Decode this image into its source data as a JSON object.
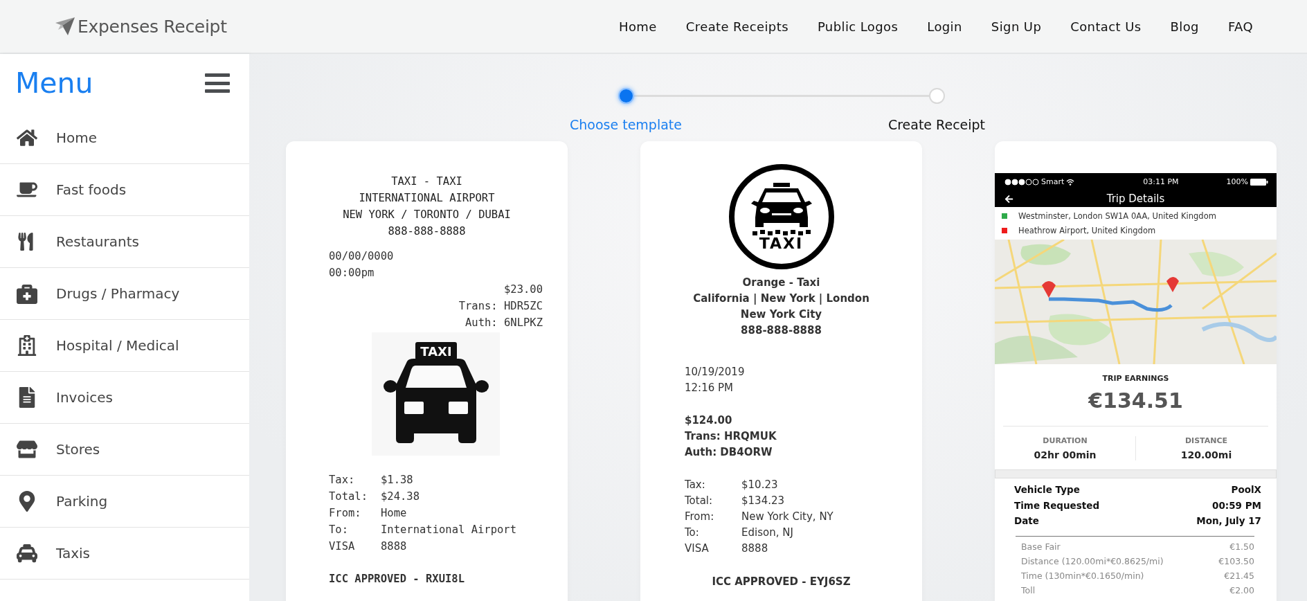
{
  "header": {
    "logo": "Expenses Receipt",
    "nav": [
      "Home",
      "Create Receipts",
      "Public Logos",
      "Login",
      "Sign Up",
      "Contact Us",
      "Blog",
      "FAQ"
    ]
  },
  "sidebar": {
    "title": "Menu",
    "items": [
      "Home",
      "Fast foods",
      "Restaurants",
      "Drugs / Pharmacy",
      "Hospital / Medical",
      "Invoices",
      "Stores",
      "Parking",
      "Taxis"
    ]
  },
  "stepper": {
    "steps": [
      {
        "label": "Choose template",
        "selected": true
      },
      {
        "label": "Create Receipt",
        "selected": false
      }
    ]
  },
  "templates": [
    {
      "kind": "thermal",
      "logo_text": "TAXI",
      "header_lines": [
        "TAXI - TAXI",
        "INTERNATIONAL AIRPORT",
        "NEW YORK / TORONTO / DUBAI",
        "888-888-8888"
      ],
      "date_lines": [
        "00/00/0000",
        "00:00pm"
      ],
      "amount_lines": [
        "$23.00",
        "Trans: HDR5ZC",
        "Auth: 6NLPKZ"
      ],
      "details": [
        {
          "label": "Tax:",
          "value": "$1.38"
        },
        {
          "label": "Total:",
          "value": "$24.38"
        },
        {
          "label": "From:",
          "value": "Home"
        },
        {
          "label": "To:",
          "value": "International Airport"
        },
        {
          "label": "VISA",
          "value": "8888"
        }
      ],
      "footer": "ICC APPROVED - RXUI8L"
    },
    {
      "kind": "classic",
      "logo_text": "TAXI",
      "header_lines": [
        "Orange - Taxi",
        "California | New York | London",
        "New York City",
        "888-888-8888"
      ],
      "date_lines": [
        "10/19/2019",
        "12:16 PM"
      ],
      "amount_lines": [
        "$124.00",
        "Trans: HRQMUK",
        "Auth: DB4ORW"
      ],
      "details": [
        {
          "label": "Tax:",
          "value": "$10.23"
        },
        {
          "label": "Total:",
          "value": "$134.23"
        },
        {
          "label": "From:",
          "value": "New York City, NY"
        },
        {
          "label": "To:",
          "value": "Edison, NJ"
        },
        {
          "label": "VISA",
          "value": "8888"
        }
      ],
      "footer": "ICC APPROVED - EYJ6SZ"
    },
    {
      "kind": "app",
      "status": {
        "carrier": "Smart",
        "time": "03:11 PM",
        "battery": "100%"
      },
      "title": "Trip Details",
      "stops": [
        {
          "text": "Westminster, London SW1A 0AA, United Kingdom",
          "color": "#2eaa4a"
        },
        {
          "text": "Heathrow Airport, United Kingdom",
          "color": "#ee1c1c"
        }
      ],
      "earnings_label": "TRIP EARNINGS",
      "earnings": "€134.51",
      "stats": [
        {
          "label": "DURATION",
          "value": "02hr 00min"
        },
        {
          "label": "DISTANCE",
          "value": "120.00mi"
        }
      ],
      "info": [
        {
          "label": "Vehicle Type",
          "value": "PoolX"
        },
        {
          "label": "Time Requested",
          "value": "00:59 PM"
        },
        {
          "label": "Date",
          "value": "Mon, July 17"
        }
      ],
      "fares": [
        {
          "label": "Base Fair",
          "value": "€1.50"
        },
        {
          "label": "Distance (120.00mi*€0.8625/mi)",
          "value": "€103.50"
        },
        {
          "label": "Time (130min*€0.1650/min)",
          "value": "€21.45"
        },
        {
          "label": "Toll",
          "value": "€2.00"
        }
      ]
    }
  ]
}
